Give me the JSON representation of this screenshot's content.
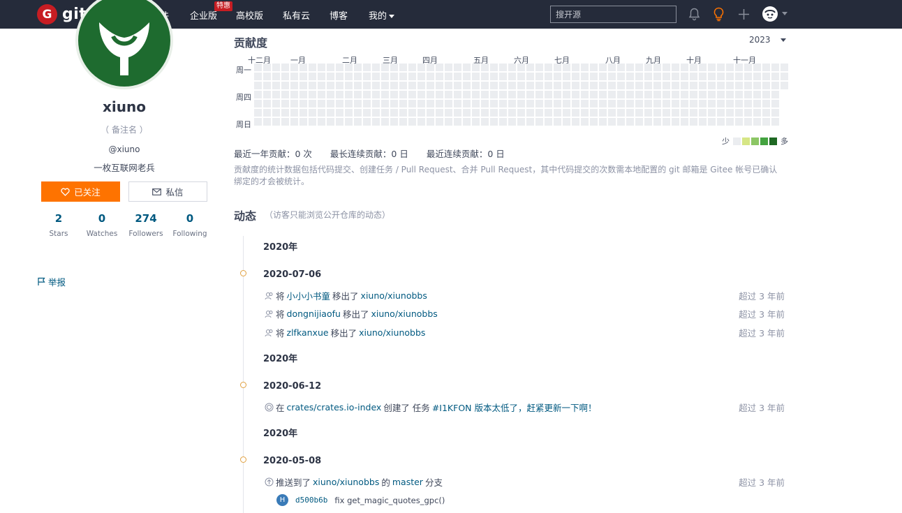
{
  "brand": {
    "logo_letter": "G",
    "name": "gitee"
  },
  "nav": {
    "items": [
      {
        "label": "开源软件"
      },
      {
        "label": "企业版"
      },
      {
        "label": "高校版"
      },
      {
        "label": "私有云"
      },
      {
        "label": "博客"
      },
      {
        "label": "我的"
      }
    ],
    "badge": "特惠",
    "search_placeholder": "搜开源"
  },
  "profile": {
    "username": "xiuno",
    "remark": "（ 备注名 ）",
    "handle": "@xiuno",
    "bio": "一枚互联网老兵",
    "follow_label": "已关注",
    "message_label": "私信",
    "stats": [
      {
        "value": "2",
        "label": "Stars"
      },
      {
        "value": "0",
        "label": "Watches"
      },
      {
        "value": "274",
        "label": "Followers"
      },
      {
        "value": "0",
        "label": "Following"
      }
    ],
    "report_label": "举报"
  },
  "contrib": {
    "title": "贡献度",
    "year": "2023",
    "months": [
      "十二月",
      "一月",
      "二月",
      "三月",
      "四月",
      "五月",
      "六月",
      "七月",
      "八月",
      "九月",
      "十月",
      "十一月"
    ],
    "weekdays": [
      "周一",
      "周四",
      "周日"
    ],
    "legend_less": "少",
    "legend_more": "多",
    "legend_colors": [
      "#ebedf0",
      "#d6e685",
      "#8cc665",
      "#44a340",
      "#1e6823"
    ],
    "stat_year": "最近一年贡献：0 次",
    "stat_longest": "最长连续贡献：0 日",
    "stat_recent": "最近连续贡献：0 日",
    "note": "贡献度的统计数据包括代码提交、创建任务 / Pull Request、合并 Pull Request，其中代码提交的次数需本地配置的 git 邮箱是 Gitee 帐号已确认绑定的才会被统计。"
  },
  "activity": {
    "title": "动态",
    "subtitle": "（访客只能浏览公开仓库的动态）",
    "groups": [
      {
        "year": "2020年",
        "date": "2020-07-06",
        "events": [
          {
            "prefix": "将",
            "user": "小小小书童",
            "mid": "移出了",
            "repo": "xiuno/xiunobbs",
            "when": "超过 3 年前"
          },
          {
            "prefix": "将",
            "user": "dongnijiaofu",
            "mid": "移出了",
            "repo": "xiuno/xiunobbs",
            "when": "超过 3 年前"
          },
          {
            "prefix": "将",
            "user": "zlfkanxue",
            "mid": "移出了",
            "repo": "xiuno/xiunobbs",
            "when": "超过 3 年前"
          }
        ]
      },
      {
        "year": "2020年",
        "date": "2020-06-12",
        "events": [
          {
            "prefix": "在",
            "repo": "crates/crates.io-index",
            "mid": "创建了 任务",
            "issue": "#I1KFON 版本太低了，赶紧更新一下啊！",
            "when": "超过 3 年前"
          }
        ]
      },
      {
        "year": "2020年",
        "date": "2020-05-08",
        "events": [
          {
            "prefix": "推送到了",
            "repo": "xiuno/xiunobbs",
            "mid": "的",
            "branch": "master",
            "suffix": "分支",
            "when": "超过 3 年前"
          }
        ],
        "commit": {
          "avatar": "H",
          "sha": "d500b6b",
          "message": "fix get_magic_quotes_gpc()"
        }
      }
    ]
  }
}
